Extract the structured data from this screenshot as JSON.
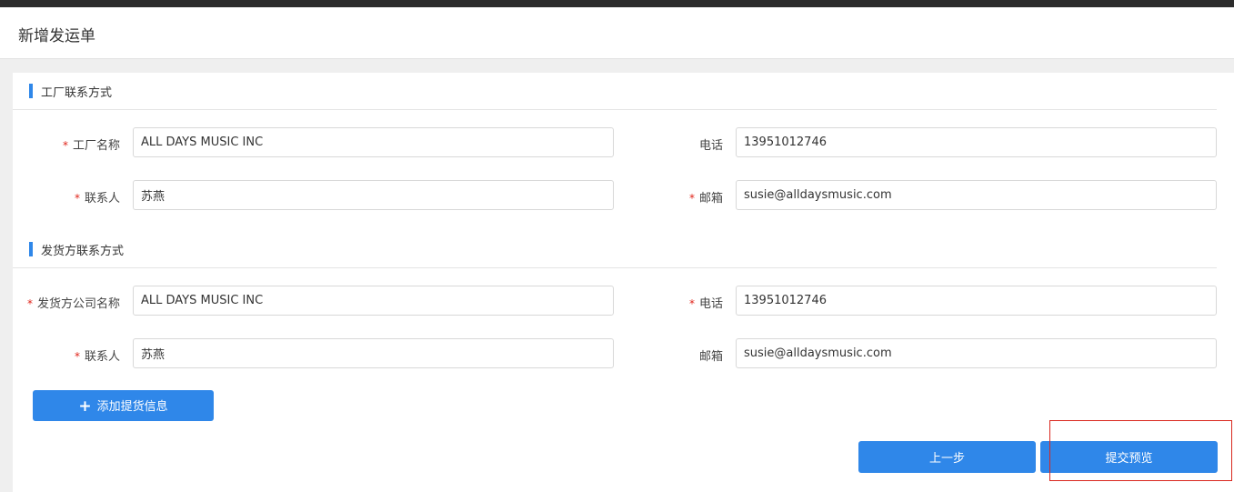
{
  "header": {
    "title": "新增发运单"
  },
  "factory_section": {
    "title": "工厂联系方式",
    "name_label": "工厂名称",
    "name_value": "ALL DAYS MUSIC INC",
    "phone_label": "电话",
    "phone_value": "13951012746",
    "contact_label": "联系人",
    "contact_value": "苏燕",
    "email_label": "邮箱",
    "email_value": "susie@alldaysmusic.com"
  },
  "shipper_section": {
    "title": "发货方联系方式",
    "company_label": "发货方公司名称",
    "company_value": "ALL DAYS MUSIC INC",
    "phone_label": "电话",
    "phone_value": "13951012746",
    "contact_label": "联系人",
    "contact_value": "苏燕",
    "email_label": "邮箱",
    "email_value": "susie@alldaysmusic.com"
  },
  "required_mark": "*",
  "actions": {
    "add_plus": "+",
    "add_label": "添加提货信息",
    "prev_label": "上一步",
    "submit_label": "提交预览"
  },
  "colors": {
    "accent": "#2f87e9",
    "required": "#e1251b",
    "highlight": "#d9271e"
  }
}
